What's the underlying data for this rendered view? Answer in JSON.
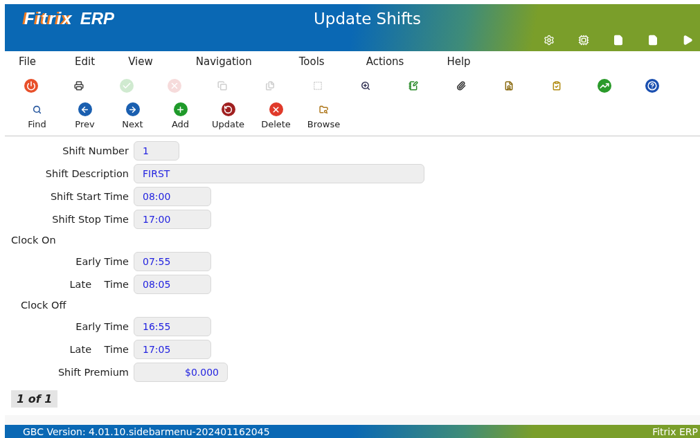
{
  "header": {
    "logo": "Fitrix",
    "logo_suffix": "ERP",
    "title": "Update Shifts",
    "icons": [
      {
        "kind": "gear"
      },
      {
        "kind": "chip"
      },
      {
        "kind": "document"
      },
      {
        "kind": "page"
      },
      {
        "kind": "play"
      }
    ]
  },
  "menu": [
    "File",
    "Edit",
    "View",
    "Navigation",
    "Tools",
    "Actions",
    "Help"
  ],
  "toolbar": [
    {
      "kind": "power",
      "disabled": false
    },
    {
      "kind": "printer",
      "disabled": false
    },
    {
      "kind": "check",
      "disabled": true
    },
    {
      "kind": "cancel",
      "disabled": true
    },
    {
      "kind": "copy",
      "disabled": true
    },
    {
      "kind": "duplicate",
      "disabled": true
    },
    {
      "kind": "select",
      "disabled": true
    },
    {
      "kind": "zoom",
      "disabled": false
    },
    {
      "kind": "notepad",
      "disabled": false
    },
    {
      "kind": "attach",
      "disabled": false
    },
    {
      "kind": "user-doc",
      "disabled": false
    },
    {
      "kind": "checklist",
      "disabled": false
    },
    {
      "kind": "chart",
      "disabled": false
    },
    {
      "kind": "help",
      "disabled": false
    }
  ],
  "actions": [
    {
      "kind": "find",
      "label": "Find"
    },
    {
      "kind": "prev",
      "label": "Prev"
    },
    {
      "kind": "next",
      "label": "Next"
    },
    {
      "kind": "add",
      "label": "Add"
    },
    {
      "kind": "update",
      "label": "Update"
    },
    {
      "kind": "delete",
      "label": "Delete"
    },
    {
      "kind": "browse",
      "label": "Browse"
    }
  ],
  "form": [
    {
      "kind": "field",
      "label": "Shift Number",
      "value": "1"
    },
    {
      "kind": "field",
      "label": "Shift Description",
      "value": "FIRST"
    },
    {
      "kind": "field",
      "label": "Shift Start Time",
      "value": "08:00"
    },
    {
      "kind": "field",
      "label": "Shift Stop Time",
      "value": "17:00"
    },
    {
      "kind": "section",
      "label": "Clock On"
    },
    {
      "kind": "field",
      "label": "Early Time",
      "value": "07:55"
    },
    {
      "kind": "field",
      "label": "Late    Time",
      "value": "08:05"
    },
    {
      "kind": "section",
      "label": "Clock Off"
    },
    {
      "kind": "field",
      "label": "Early Time",
      "value": "16:55"
    },
    {
      "kind": "field",
      "label": "Late    Time",
      "value": "17:05"
    },
    {
      "kind": "field",
      "label": "Shift Premium",
      "value": "$0.000"
    }
  ],
  "record_count": "1 of 1",
  "status_bar": {
    "version": "GBC Version: 4.01.10.sidebarmenu-202401162045",
    "product": "Fitrix ERP"
  }
}
